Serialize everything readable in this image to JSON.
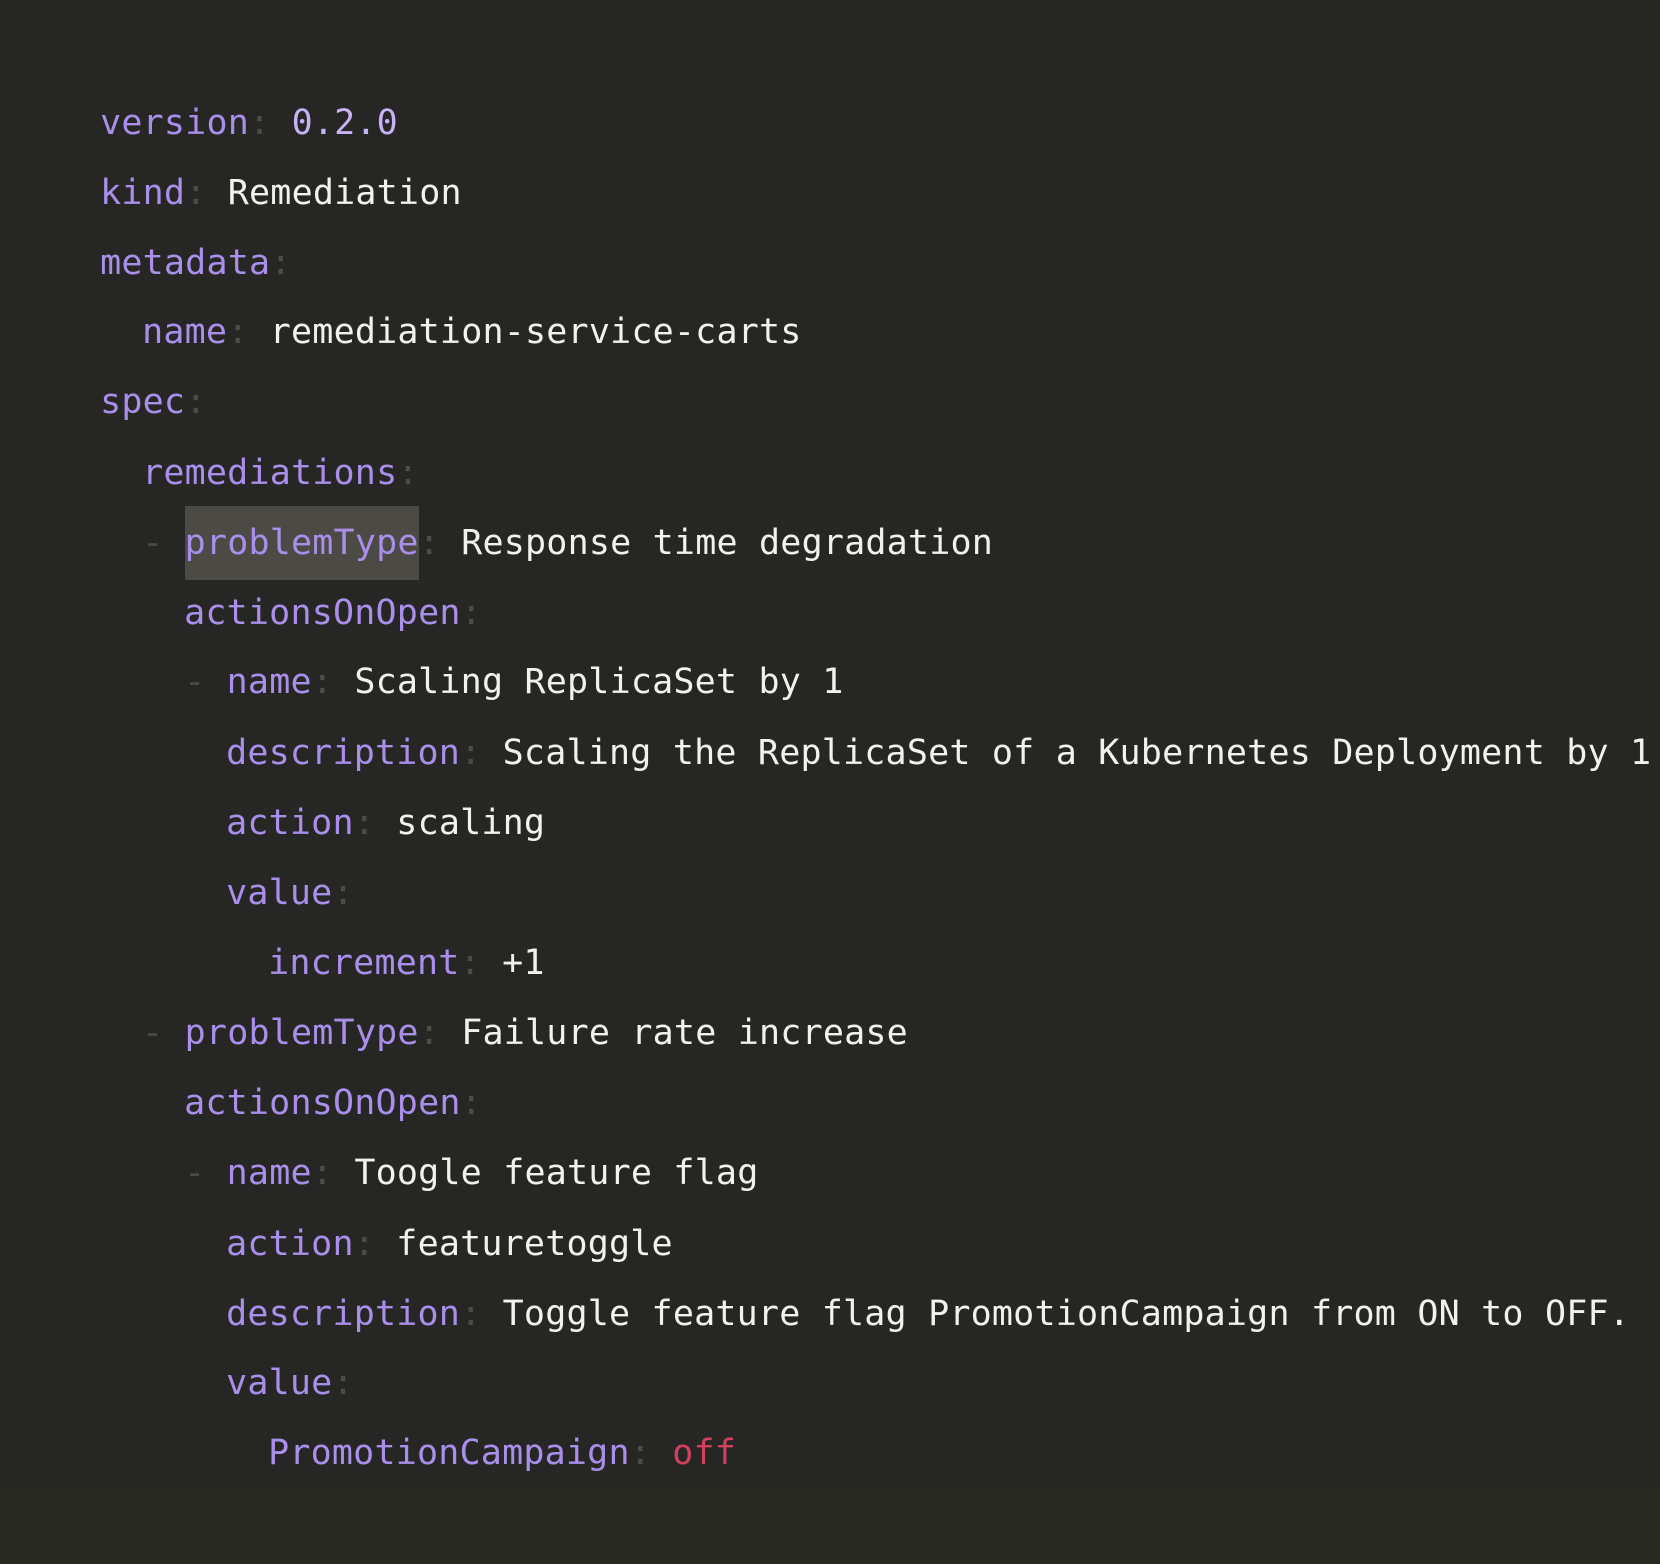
{
  "accent_colors": {
    "key": "#a98fea",
    "value": "#f2f2ec",
    "number": "#c6b2f4",
    "boolean": "#d1405e",
    "punctuation": "#4c4c47",
    "background": "#262624"
  },
  "lines": [
    {
      "key": "version",
      "value": "0.2.0"
    },
    {
      "key": "kind",
      "value": "Remediation"
    },
    {
      "key": "metadata",
      "value": ""
    },
    {
      "key": "name",
      "value": "remediation-service-carts"
    },
    {
      "key": "spec",
      "value": ""
    },
    {
      "key": "remediations",
      "value": ""
    },
    {
      "dash": "-",
      "key": "problemType",
      "value": "Response time degradation"
    },
    {
      "key": "actionsOnOpen",
      "value": ""
    },
    {
      "dash": "-",
      "key": "name",
      "value": "Scaling ReplicaSet by 1"
    },
    {
      "key": "description",
      "value": "Scaling the ReplicaSet of a Kubernetes Deployment by 1"
    },
    {
      "key": "action",
      "value": "scaling"
    },
    {
      "key": "value",
      "value": ""
    },
    {
      "key": "increment",
      "value": "+1"
    },
    {
      "dash": "-",
      "key": "problemType",
      "value": "Failure rate increase"
    },
    {
      "key": "actionsOnOpen",
      "value": ""
    },
    {
      "dash": "-",
      "key": "name",
      "value": "Toogle feature flag"
    },
    {
      "key": "action",
      "value": "featuretoggle"
    },
    {
      "key": "description",
      "value": "Toggle feature flag PromotionCampaign from ON to OFF."
    },
    {
      "key": "value",
      "value": ""
    },
    {
      "key": "PromotionCampaign",
      "value": "off"
    }
  ],
  "colon": ":"
}
